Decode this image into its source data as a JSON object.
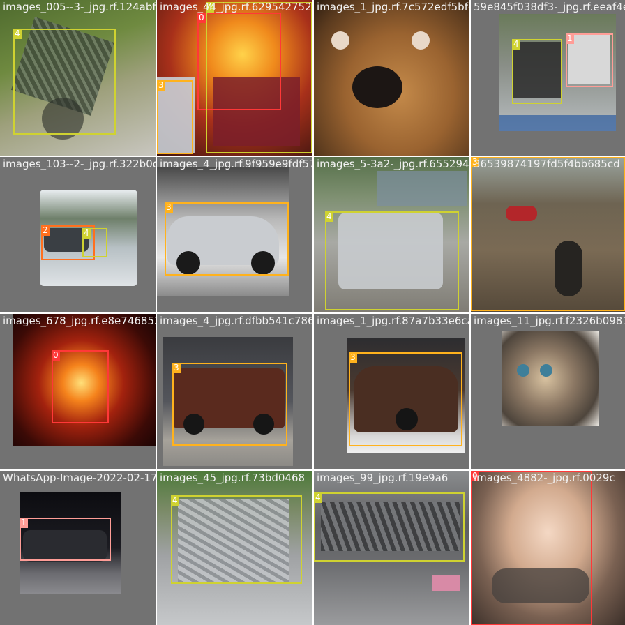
{
  "grid": {
    "rows": 4,
    "cols": 4,
    "class_colors": {
      "0": "#ff3838",
      "1": "#ff9d97",
      "2": "#ff701f",
      "3": "#ffb21d",
      "4": "#cfd231"
    },
    "tiles": [
      {
        "filename": "images_005--3-_jpg.rf.124abf1a5a",
        "subject": "overturned truck on road",
        "labels": [
          "4"
        ]
      },
      {
        "filename": "images_44_jpg.rf.6295427524338d5e",
        "subject": "burning truck",
        "labels": [
          "0",
          "4",
          "3"
        ]
      },
      {
        "filename": "images_1_jpg.rf.7c572edf5bfc4c8422",
        "subject": "dog close-up",
        "labels": []
      },
      {
        "filename": "59e845f038df3-_jpg.rf.eeaf4e",
        "subject": "crashed vehicles on roadside",
        "labels": [
          "4",
          "1"
        ]
      },
      {
        "filename": "images_103--2-_jpg.rf.322b0d3d9823a9a4",
        "subject": "car on road",
        "labels": [
          "2",
          "4"
        ]
      },
      {
        "filename": "images_4_jpg.rf.9f959e9fdf573d9",
        "subject": "silver car",
        "labels": [
          "3"
        ]
      },
      {
        "filename": "images_5-3a2-_jpg.rf.655294f58f0",
        "subject": "wrecked car",
        "labels": [
          "4"
        ]
      },
      {
        "filename": "36539874197fd5f4bb685cd",
        "subject": "brown SUV rear",
        "labels": [
          "3"
        ]
      },
      {
        "filename": "images_678_jpg.rf.e8e7468530079e975",
        "subject": "car fire at night",
        "labels": [
          "0"
        ]
      },
      {
        "filename": "images_4_jpg.rf.dfbb541c786215081",
        "subject": "brown pickup truck",
        "labels": [
          "3"
        ]
      },
      {
        "filename": "images_1_jpg.rf.87a7b33e6ca77a6085",
        "subject": "brown sedan",
        "labels": [
          "3"
        ]
      },
      {
        "filename": "images_11_jpg.rf.f2326b098147ff9a4",
        "subject": "kitten",
        "labels": []
      },
      {
        "filename": "WhatsApp-Image-2022-02-17",
        "subject": "damaged car at night",
        "labels": [
          "1"
        ]
      },
      {
        "filename": "images_45_jpg.rf.73bd0468",
        "subject": "crashed car",
        "labels": [
          "4"
        ]
      },
      {
        "filename": "images_99_jpg.rf.19e9a6",
        "subject": "crash debris on road",
        "labels": [
          "4"
        ]
      },
      {
        "filename": "images_4882-_jpg.rf.0029c",
        "subject": "fire",
        "labels": [
          "0"
        ]
      }
    ]
  }
}
